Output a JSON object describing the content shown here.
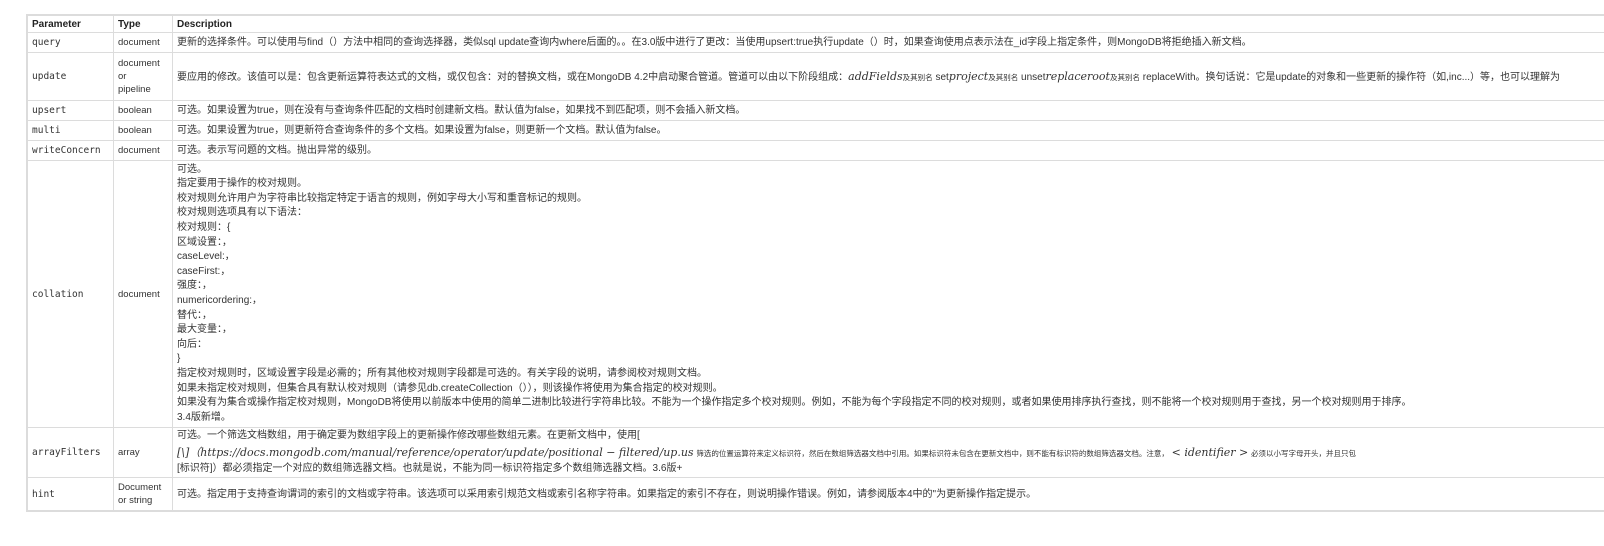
{
  "table": {
    "headers": {
      "parameter": "Parameter",
      "type": "Type",
      "description": "Description"
    },
    "rows": [
      {
        "param": "query",
        "type": "document",
        "desc": "更新的选择条件。可以使用与find（）方法中相同的查询选择器，类似sql update查询内where后面的。。在3.0版中进行了更改：当使用upsert:true执行update（）时，如果查询使用点表示法在_id字段上指定条件，则MongoDB将拒绝插入新文档。"
      },
      {
        "param": "update",
        "type_lines": [
          "document",
          "or",
          "pipeline"
        ],
        "desc_a": "要应用的修改。该值可以是：包含更新运算符表达式的文档，或仅包含：对的替换文档，或在MongoDB 4.2中启动聚合管道。管道可以由以下阶段组成：",
        "desc_m1": "addFields",
        "desc_t1": "及其别名",
        "desc_b": " set",
        "desc_m2": "project",
        "desc_t2": "及其别名",
        "desc_c": " unset",
        "desc_m3": "replaceroot",
        "desc_t3": "及其别名",
        "desc_d": " replaceWith。换句话说：它是update的对象和一些更新的操作符（如,inc...）等，也可以理解为"
      },
      {
        "param": "upsert",
        "type": "boolean",
        "desc": "可选。如果设置为true，则在没有与查询条件匹配的文档时创建新文档。默认值为false，如果找不到匹配项，则不会插入新文档。"
      },
      {
        "param": "multi",
        "type": "boolean",
        "desc": "可选。如果设置为true，则更新符合查询条件的多个文档。如果设置为false，则更新一个文档。默认值为false。"
      },
      {
        "param": "writeConcern",
        "type": "document",
        "desc": "可选。表示写问题的文档。抛出异常的级别。"
      },
      {
        "param": "collation",
        "type": "document",
        "desc_lines": [
          "可选。",
          "指定要用于操作的校对规则。",
          "校对规则允许用户为字符串比较指定特定于语言的规则，例如字母大小写和重音标记的规则。",
          "校对规则选项具有以下语法：",
          "校对规则：{",
          "区域设置：，",
          "caseLevel:，",
          "caseFirst:，",
          "强度：，",
          "numericordering:，",
          "替代：，",
          "最大变量：，",
          "向后：",
          "}",
          "指定校对规则时，区域设置字段是必需的；所有其他校对规则字段都是可选的。有关字段的说明，请参阅校对规则文档。",
          "如果未指定校对规则，但集合具有默认校对规则（请参见db.createCollection（）），则该操作将使用为集合指定的校对规则。",
          "如果没有为集合或操作指定校对规则，MongoDB将使用以前版本中使用的简单二进制比较进行字符串比较。不能为一个操作指定多个校对规则。例如，不能为每个字段指定不同的校对规则，或者如果使用排序执行查找，则不能将一个校对规则用于查找，另一个校对规则用于排序。",
          "3.4版新增。"
        ]
      },
      {
        "param": "arrayFilters",
        "type": "array",
        "desc_line1": "可选。一个筛选文档数组，用于确定要为数组字段上的更新操作修改哪些数组元素。在更新文档中，使用[",
        "desc_line2_math": "[\\]（https://docs.mongodb.com/manual/reference/operator/update/positional − filtered/up.us",
        "desc_line2_tiny": "筛选的位置运算符来定义标识符，然后在数组筛选器文档中引用。如果标识符未包含在更新文档中，则不能有标识符的数组筛选器文档。注意，",
        "desc_line2_math2": "< identifier >",
        "desc_line2_tiny2": "必须以小写字母开头，并且只包",
        "desc_line3": "[标识符]）都必须指定一个对应的数组筛选器文档。也就是说，不能为同一标识符指定多个数组筛选器文档。3.6版+"
      },
      {
        "param": "hint",
        "type_lines": [
          "Document",
          "or string"
        ],
        "desc": "可选。指定用于支持查询谓词的索引的文档或字符串。该选项可以采用索引规范文档或索引名称字符串。如果指定的索引不存在，则说明操作错误。例如，请参阅版本4中的\"为更新操作指定提示。"
      }
    ]
  }
}
